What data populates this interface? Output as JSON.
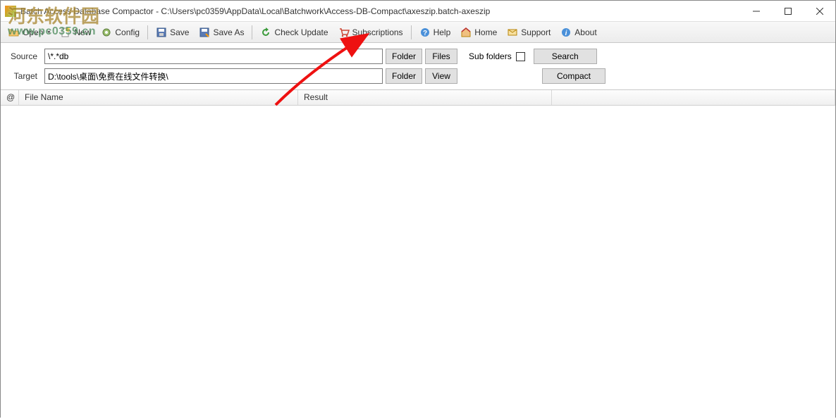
{
  "window": {
    "title": "Batch Access Database Compactor - C:\\Users\\pc0359\\AppData\\Local\\Batchwork\\Access-DB-Compact\\axeszip.batch-axeszip"
  },
  "toolbar": {
    "open": "Open",
    "new": "New",
    "config": "Config",
    "save": "Save",
    "save_as": "Save As",
    "check_update": "Check Update",
    "subscriptions": "Subscriptions",
    "help": "Help",
    "home": "Home",
    "support": "Support",
    "about": "About"
  },
  "form": {
    "source_label": "Source",
    "source_value": "\\*.*db",
    "target_label": "Target",
    "target_value": "D:\\tools\\桌面\\免费在线文件转换\\",
    "folder_btn": "Folder",
    "files_btn": "Files",
    "view_btn": "View",
    "sub_folders_label": "Sub folders",
    "search_btn": "Search",
    "compact_btn": "Compact"
  },
  "columns": {
    "at": "@",
    "filename": "File Name",
    "result": "Result"
  },
  "watermark": {
    "text": "河东软件园",
    "url": "www.pc0359.cn"
  }
}
